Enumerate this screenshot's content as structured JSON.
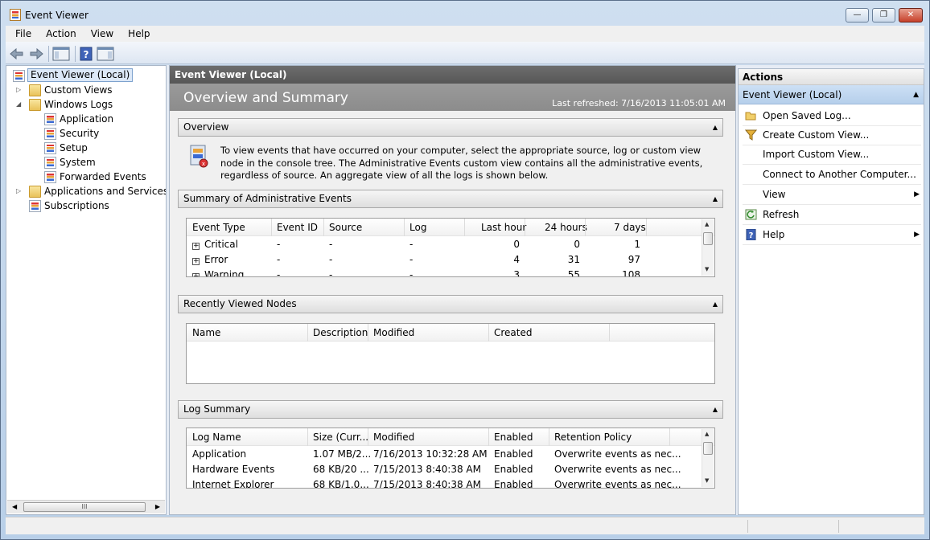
{
  "window": {
    "title": "Event Viewer",
    "min": "—",
    "max": "❐",
    "close": "✕"
  },
  "menu": [
    "File",
    "Action",
    "View",
    "Help"
  ],
  "tree": {
    "root": "Event Viewer (Local)",
    "custom_views": "Custom Views",
    "windows_logs": "Windows Logs",
    "logs": [
      "Application",
      "Security",
      "Setup",
      "System",
      "Forwarded Events"
    ],
    "apps_services": "Applications and Services Lo",
    "subscriptions": "Subscriptions"
  },
  "center": {
    "header": "Event Viewer (Local)",
    "title": "Overview and Summary",
    "refreshed": "Last refreshed: 7/16/2013 11:05:01 AM",
    "overview": {
      "heading": "Overview",
      "text": "To view events that have occurred on your computer, select the appropriate source, log or custom view node in the console tree. The Administrative Events custom view contains all the administrative events, regardless of source. An aggregate view of all the logs is shown below."
    },
    "summary": {
      "heading": "Summary of Administrative Events",
      "columns": [
        "Event Type",
        "Event ID",
        "Source",
        "Log",
        "Last hour",
        "24 hours",
        "7 days"
      ],
      "rows": [
        [
          "Critical",
          "-",
          "-",
          "-",
          "0",
          "0",
          "1"
        ],
        [
          "Error",
          "-",
          "-",
          "-",
          "4",
          "31",
          "97"
        ],
        [
          "Warning",
          "-",
          "-",
          "-",
          "3",
          "55",
          "108"
        ]
      ]
    },
    "recent": {
      "heading": "Recently Viewed Nodes",
      "columns": [
        "Name",
        "Description",
        "Modified",
        "Created"
      ]
    },
    "logsummary": {
      "heading": "Log Summary",
      "columns": [
        "Log Name",
        "Size (Curr...",
        "Modified",
        "Enabled",
        "Retention Policy"
      ],
      "rows": [
        [
          "Application",
          "1.07 MB/2...",
          "7/16/2013 10:32:28 AM",
          "Enabled",
          "Overwrite events as nec..."
        ],
        [
          "Hardware Events",
          "68 KB/20 ...",
          "7/15/2013 8:40:38 AM",
          "Enabled",
          "Overwrite events as nec..."
        ],
        [
          "Internet Explorer",
          "68 KB/1.0...",
          "7/15/2013 8:40:38 AM",
          "Enabled",
          "Overwrite events as nec..."
        ]
      ]
    }
  },
  "actions": {
    "heading": "Actions",
    "group": "Event Viewer (Local)",
    "items": [
      "Open Saved Log...",
      "Create Custom View...",
      "Import Custom View...",
      "Connect to Another Computer...",
      "View",
      "Refresh",
      "Help"
    ]
  },
  "scroll_thumb": "III"
}
